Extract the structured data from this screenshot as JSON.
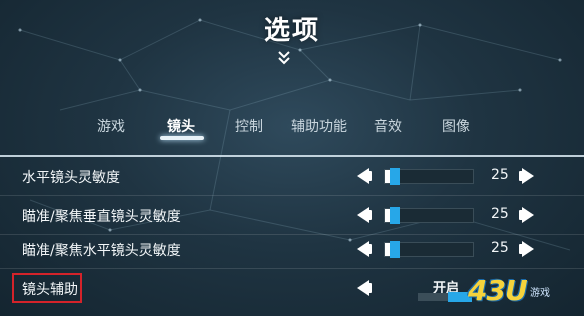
{
  "header": {
    "title": "选项"
  },
  "tabs": [
    {
      "label": "游戏",
      "active": false
    },
    {
      "label": "镜头",
      "active": true
    },
    {
      "label": "控制",
      "active": false
    },
    {
      "label": "辅助功能",
      "active": false
    },
    {
      "label": "音效",
      "active": false
    },
    {
      "label": "图像",
      "active": false
    }
  ],
  "settings": [
    {
      "label": "水平镜头灵敏度",
      "type": "slider",
      "value": "25",
      "level": 0.06
    },
    {
      "label": "瞄准/聚焦垂直镜头灵敏度",
      "type": "slider",
      "value": "25",
      "level": 0.06
    },
    {
      "label": "瞄准/聚焦水平镜头灵敏度",
      "type": "slider",
      "value": "25",
      "level": 0.06
    },
    {
      "label": "镜头辅助",
      "type": "toggle",
      "value": "开启"
    }
  ],
  "watermark": {
    "main": "43U",
    "sub": "游戏"
  },
  "colors": {
    "accent": "#27a7e8",
    "highlight": "#d4232a",
    "background": "#1f3442"
  },
  "icons": [
    "double-chevron-down-icon",
    "arrow-left-icon",
    "arrow-right-icon"
  ]
}
